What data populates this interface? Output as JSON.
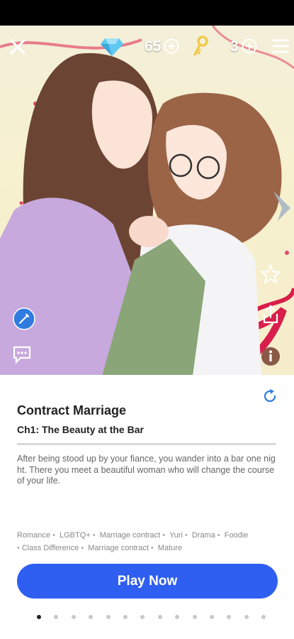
{
  "header": {
    "gems_count": "65",
    "keys_count": "3"
  },
  "story": {
    "title": "Contract Marriage",
    "chapter": "Ch1: The Beauty at the Bar",
    "description": "After being stood up by your fiance, you wander into a bar one night. There you meet a beautiful woman who will change the course of your life.",
    "tags": [
      "Romance",
      "LGBTQ+",
      "Marriage contract",
      "Yuri",
      "Drama",
      "Foodie",
      "Class Difference",
      "Marriage contract",
      "Mature"
    ]
  },
  "actions": {
    "play_label": "Play Now"
  },
  "pagination": {
    "total": 14,
    "active_index": 0
  },
  "colors": {
    "accent": "#2f5ff0",
    "gem": "#5ec8f0",
    "key": "#f2c94c",
    "refresh": "#2f7be0"
  },
  "icons": [
    "close-icon",
    "gem-icon",
    "add-gems-icon",
    "key-icon",
    "add-keys-icon",
    "menu-icon",
    "arrow-next-icon",
    "star-icon",
    "share-icon",
    "info-icon",
    "pen-badge-icon",
    "chat-icon",
    "refresh-icon"
  ]
}
